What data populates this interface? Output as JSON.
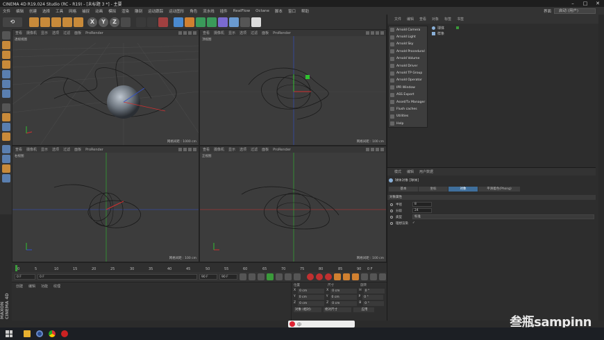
{
  "window": {
    "title": "CINEMA 4D R19.024 Studio (RC - R19) - [未标题 3 *] - 主要"
  },
  "menubar": {
    "items": [
      "文件",
      "编辑",
      "创建",
      "选择",
      "工具",
      "网格",
      "捕捉",
      "动画",
      "模拟",
      "渲染",
      "雕刻",
      "运动跟踪",
      "运动图形",
      "角色",
      "流水线",
      "插件",
      "RealFlow",
      "Octane",
      "脚本",
      "窗口",
      "帮助"
    ],
    "layout_label": "界面",
    "layout_value": "启动 (用户)"
  },
  "viewports": [
    {
      "label": "透视视图",
      "menus": [
        "查看",
        "摄像机",
        "显示",
        "选项",
        "过滤",
        "面板",
        "ProRender"
      ],
      "footer": "网格间距 : 1000 cm"
    },
    {
      "label": "顶视图",
      "menus": [
        "查看",
        "摄像机",
        "显示",
        "选项",
        "过滤",
        "面板",
        "ProRender"
      ],
      "footer": "网格间距 : 100 cm"
    },
    {
      "label": "右视图",
      "menus": [
        "查看",
        "摄像机",
        "显示",
        "选项",
        "过滤",
        "面板",
        "ProRender"
      ],
      "footer": "网格间距 : 100 cm"
    },
    {
      "label": "正视图",
      "menus": [
        "查看",
        "摄像机",
        "显示",
        "选项",
        "过滤",
        "面板",
        "ProRender"
      ],
      "footer": "网格间距 : 100 cm"
    }
  ],
  "timeline": {
    "ticks": [
      "0",
      "5",
      "10",
      "15",
      "20",
      "25",
      "30",
      "35",
      "40",
      "45",
      "50",
      "55",
      "60",
      "65",
      "70",
      "75",
      "80",
      "85",
      "90"
    ],
    "end": "0 F",
    "start_field": "0 F",
    "current_field": "0 F",
    "end_field": "90 F",
    "end_field2": "90 F"
  },
  "material": {
    "menus": [
      "创建",
      "编辑",
      "功能",
      "纹理"
    ]
  },
  "coords": {
    "headers": [
      "位置",
      "尺寸",
      "旋转"
    ],
    "rows": [
      [
        "X",
        "0 cm",
        "X",
        "0 cm",
        "H",
        "0 °"
      ],
      [
        "Y",
        "0 cm",
        "Y",
        "0 cm",
        "P",
        "0 °"
      ],
      [
        "Z",
        "0 cm",
        "Z",
        "0 cm",
        "B",
        "0 °"
      ]
    ],
    "mode": "对象 (相对)",
    "size_mode": "绝对尺寸",
    "apply": "应用"
  },
  "objects": {
    "menus": [
      "文件",
      "编辑",
      "查看",
      "对象",
      "标签",
      "书签"
    ],
    "items": [
      "球体",
      "样条"
    ]
  },
  "arnold_menu": [
    "Arnold Camera",
    "Arnold Light",
    "Arnold Sky",
    "Arnold Procedural",
    "Arnold Volume",
    "Arnold Driver",
    "Arnold TP Group",
    "Arnold Operator",
    "IPR Window",
    "ASS Export",
    "Asset/Tx Manager",
    "Flush caches",
    "Utilities",
    "Help"
  ],
  "attributes": {
    "menus": [
      "模式",
      "编辑",
      "用户数据"
    ],
    "title": "球体对象 [球体]",
    "tabs": [
      "基本",
      "坐标",
      "对象",
      "平滑着色(Phong)"
    ],
    "active_tab": "对象",
    "section": "对象属性",
    "props": [
      {
        "label": "半径",
        "value": "8"
      },
      {
        "label": "分段",
        "value": "24"
      }
    ],
    "type_label": "类型",
    "type_value": "标准",
    "render_label": "理想渲染",
    "render_value": "✓"
  },
  "watermark": "叁瓶sampinn",
  "brand": "MAXON CINEMA 4D",
  "ime": "中"
}
